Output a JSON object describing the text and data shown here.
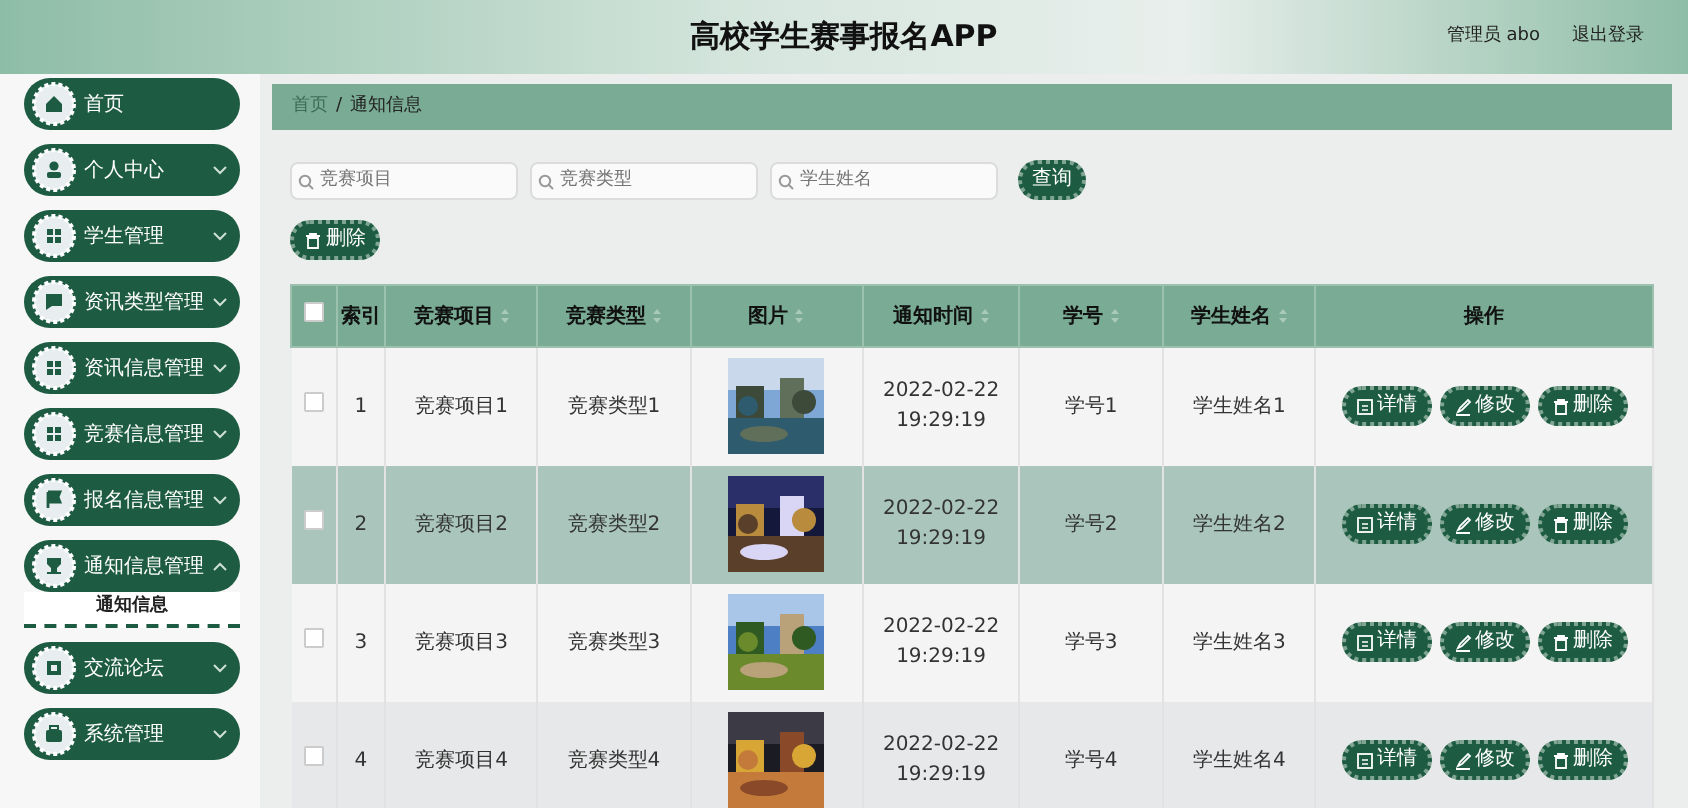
{
  "header": {
    "title": "高校学生赛事报名APP",
    "user": "管理员 abo",
    "logout": "退出登录"
  },
  "sidebar": {
    "items": [
      {
        "label": "首页",
        "kind": "link"
      },
      {
        "label": "个人中心",
        "kind": "menu",
        "expanded": false
      },
      {
        "label": "学生管理",
        "kind": "menu",
        "expanded": false
      },
      {
        "label": "资讯类型管理",
        "kind": "menu",
        "expanded": false
      },
      {
        "label": "资讯信息管理",
        "kind": "menu",
        "expanded": false
      },
      {
        "label": "竞赛信息管理",
        "kind": "menu",
        "expanded": false
      },
      {
        "label": "报名信息管理",
        "kind": "menu",
        "expanded": false
      },
      {
        "label": "通知信息管理",
        "kind": "menu",
        "expanded": true,
        "children": [
          {
            "label": "通知信息",
            "selected": true
          }
        ]
      },
      {
        "label": "交流论坛",
        "kind": "menu",
        "expanded": false
      },
      {
        "label": "系统管理",
        "kind": "menu",
        "expanded": false
      }
    ]
  },
  "breadcrumb": [
    "首页",
    "/",
    "通知信息"
  ],
  "search": {
    "fields": [
      {
        "placeholder": "竞赛项目"
      },
      {
        "placeholder": "竞赛类型"
      },
      {
        "placeholder": "学生姓名"
      }
    ],
    "button": "查询"
  },
  "delete_button": "删除",
  "table": {
    "select_all_checked": false,
    "columns": [
      {
        "kind": "check"
      },
      {
        "label": "索引",
        "kind": "text",
        "sortable": false
      },
      {
        "label": "竞赛项目",
        "kind": "text",
        "sortable": true
      },
      {
        "label": "竞赛类型",
        "kind": "text",
        "sortable": true
      },
      {
        "label": "图片",
        "kind": "text",
        "sortable": true
      },
      {
        "label": "通知时间",
        "kind": "text",
        "sortable": true
      },
      {
        "label": "学号",
        "kind": "text",
        "sortable": true
      },
      {
        "label": "学生姓名",
        "kind": "text",
        "sortable": true
      },
      {
        "label": "操作",
        "kind": "text",
        "sortable": false
      }
    ],
    "rows": [
      {
        "index": "1",
        "project": "竞赛项目1",
        "type": "竞赛类型1",
        "picture": {
          "kind": "picture"
        },
        "time": "2022-02-22 19:29:19",
        "student_no": "学号1",
        "student_name": "学生姓名1",
        "selected": false,
        "checked": false,
        "actions": [
          "详情",
          "修改",
          "删除"
        ]
      },
      {
        "index": "2",
        "project": "竞赛项目2",
        "type": "竞赛类型2",
        "picture": {
          "kind": "picture"
        },
        "time": "2022-02-22 19:29:19",
        "student_no": "学号2",
        "student_name": "学生姓名2",
        "selected": true,
        "checked": false,
        "actions": [
          "详情",
          "修改",
          "删除"
        ]
      },
      {
        "index": "3",
        "project": "竞赛项目3",
        "type": "竞赛类型3",
        "picture": {
          "kind": "picture"
        },
        "time": "2022-02-22 19:29:19",
        "student_no": "学号3",
        "student_name": "学生姓名3",
        "selected": false,
        "checked": false,
        "actions": [
          "详情",
          "修改",
          "删除"
        ]
      },
      {
        "index": "4",
        "project": "竞赛项目4",
        "type": "竞赛类型4",
        "picture": {
          "kind": "picture"
        },
        "time": "2022-02-22 19:29:19",
        "student_no": "学号4",
        "student_name": "学生姓名4",
        "selected": false,
        "checked": false,
        "actions": [
          "详情",
          "修改",
          "删除"
        ]
      }
    ]
  }
}
